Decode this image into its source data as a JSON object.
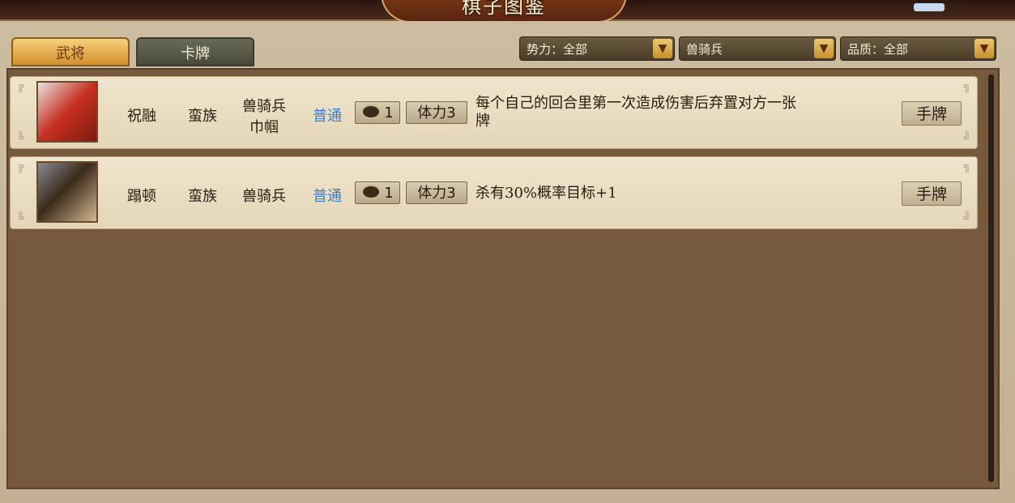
{
  "title": "棋子图鉴",
  "tabs": [
    {
      "label": "武将",
      "active": true
    },
    {
      "label": "卡牌",
      "active": false
    }
  ],
  "filters": [
    {
      "label": "势力：全部"
    },
    {
      "label": "兽骑兵"
    },
    {
      "label": "品质：全部"
    }
  ],
  "rows": [
    {
      "name": "祝融",
      "faction": "蛮族",
      "class_line1": "兽骑兵",
      "class_line2": "巾帼",
      "quality": "普通",
      "cost": "1",
      "stamina": "体力3",
      "description_line1": "每个自己的回合里第一次造成伤害后弃置对方一张",
      "description_line2": "牌",
      "hand_label": "手牌"
    },
    {
      "name": "蹋顿",
      "faction": "蛮族",
      "class_line1": "兽骑兵",
      "quality": "普通",
      "cost": "1",
      "stamina": "体力3",
      "description_line1": "杀有30%概率目标+1",
      "hand_label": "手牌"
    }
  ],
  "colors": {
    "quality_common": "#3a7ed0",
    "tab_active": "#e0a84a",
    "panel_bg": "#77593d"
  }
}
